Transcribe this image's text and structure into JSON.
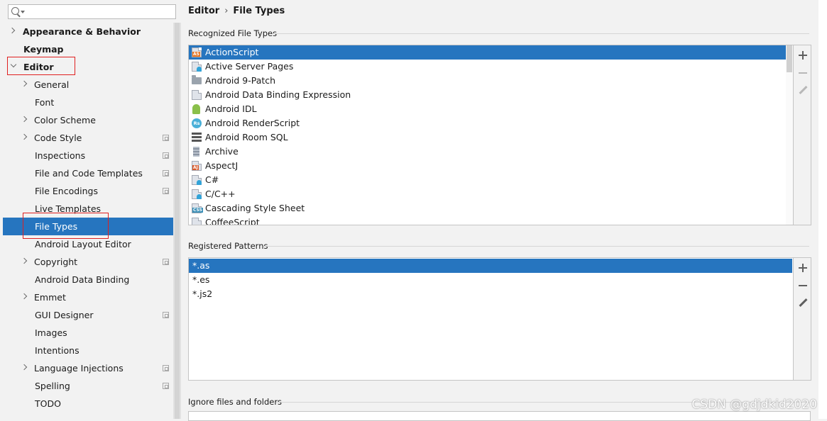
{
  "search": {
    "placeholder": ""
  },
  "sidebar": {
    "items": [
      {
        "label": "Appearance & Behavior",
        "expander": "collapsed"
      },
      {
        "label": "Keymap"
      },
      {
        "label": "Editor",
        "expander": "expanded"
      },
      {
        "label": "General",
        "expander": "collapsed"
      },
      {
        "label": "Font"
      },
      {
        "label": "Color Scheme",
        "expander": "collapsed"
      },
      {
        "label": "Code Style",
        "expander": "collapsed",
        "project_icon": true
      },
      {
        "label": "Inspections",
        "project_icon": true
      },
      {
        "label": "File and Code Templates",
        "project_icon": true
      },
      {
        "label": "File Encodings",
        "project_icon": true
      },
      {
        "label": "Live Templates"
      },
      {
        "label": "File Types",
        "selected": true
      },
      {
        "label": "Android Layout Editor"
      },
      {
        "label": "Copyright",
        "expander": "collapsed",
        "project_icon": true
      },
      {
        "label": "Android Data Binding"
      },
      {
        "label": "Emmet",
        "expander": "collapsed"
      },
      {
        "label": "GUI Designer",
        "project_icon": true
      },
      {
        "label": "Images"
      },
      {
        "label": "Intentions"
      },
      {
        "label": "Language Injections",
        "expander": "collapsed",
        "project_icon": true
      },
      {
        "label": "Spelling",
        "project_icon": true
      },
      {
        "label": "TODO"
      }
    ]
  },
  "breadcrumb": {
    "parent": "Editor",
    "separator": "›",
    "current": "File Types"
  },
  "recognized": {
    "title": "Recognized File Types",
    "items": [
      {
        "label": "ActionScript",
        "icon": "actionscript-file-icon",
        "tag": "AS",
        "tag_color": "#e5731f",
        "selected": true
      },
      {
        "label": "Active Server Pages",
        "icon": "asp-file-icon"
      },
      {
        "label": "Android 9-Patch",
        "icon": "folder-icon"
      },
      {
        "label": "Android Data Binding Expression",
        "icon": "databinding-file-icon"
      },
      {
        "label": "Android IDL",
        "icon": "android-icon"
      },
      {
        "label": "Android RenderScript",
        "icon": "renderscript-icon",
        "tag": "Rs"
      },
      {
        "label": "Android Room SQL",
        "icon": "database-icon"
      },
      {
        "label": "Archive",
        "icon": "archive-icon"
      },
      {
        "label": "AspectJ",
        "icon": "aspectj-file-icon",
        "tag": "AJ",
        "tag_color": "#d95a2b"
      },
      {
        "label": "C#",
        "icon": "csharp-file-icon"
      },
      {
        "label": "C/C++",
        "icon": "cpp-file-icon"
      },
      {
        "label": "Cascading Style Sheet",
        "icon": "css-file-icon",
        "tag": "CSS",
        "tag_color": "#3a8fb7"
      },
      {
        "label": "CoffeeScript",
        "icon": "coffeescript-file-icon"
      }
    ]
  },
  "patterns": {
    "title": "Registered Patterns",
    "items": [
      {
        "label": "*.as",
        "selected": true
      },
      {
        "label": "*.es"
      },
      {
        "label": "*.js2"
      }
    ]
  },
  "ignore": {
    "title": "Ignore files and folders"
  },
  "watermark": "CSDN @gdjdkid2020",
  "colors": {
    "selection": "#2675bf",
    "highlight_box": "#e02020"
  }
}
